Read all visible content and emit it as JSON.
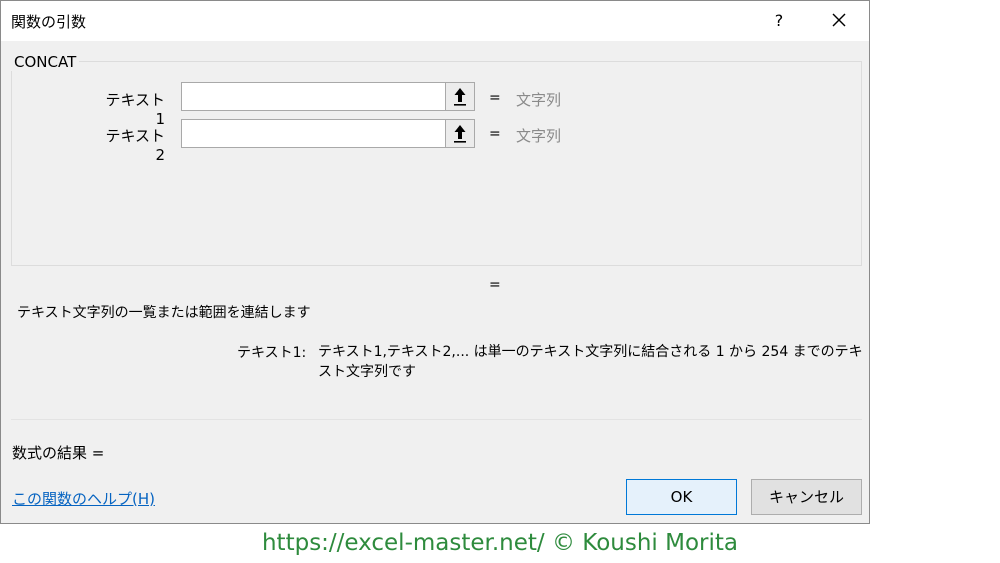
{
  "dialog": {
    "title": "関数の引数",
    "help_button": "?",
    "function_name": "CONCAT"
  },
  "args": [
    {
      "label": "テキスト1",
      "value": "",
      "eq": "=",
      "type_hint": "文字列"
    },
    {
      "label": "テキスト2",
      "value": "",
      "eq": "=",
      "type_hint": "文字列"
    }
  ],
  "result_eq": "=",
  "description": "テキスト文字列の一覧または範囲を連結します",
  "arg_description": {
    "label": "テキスト1:",
    "text": "テキスト1,テキスト2,... は単一のテキスト文字列に結合される 1 から 254 までのテキスト文字列です"
  },
  "formula_result": "数式の結果 =",
  "help_link": "この関数のヘルプ(H)",
  "buttons": {
    "ok": "OK",
    "cancel": "キャンセル"
  },
  "watermark": "https://excel-master.net/  © Koushi Morita",
  "icons": {
    "close": "close-icon",
    "collapse": "arrow-up-icon"
  },
  "colors": {
    "link": "#0563c1",
    "ok_border": "#0078d7",
    "watermark": "#2e8b3d"
  }
}
